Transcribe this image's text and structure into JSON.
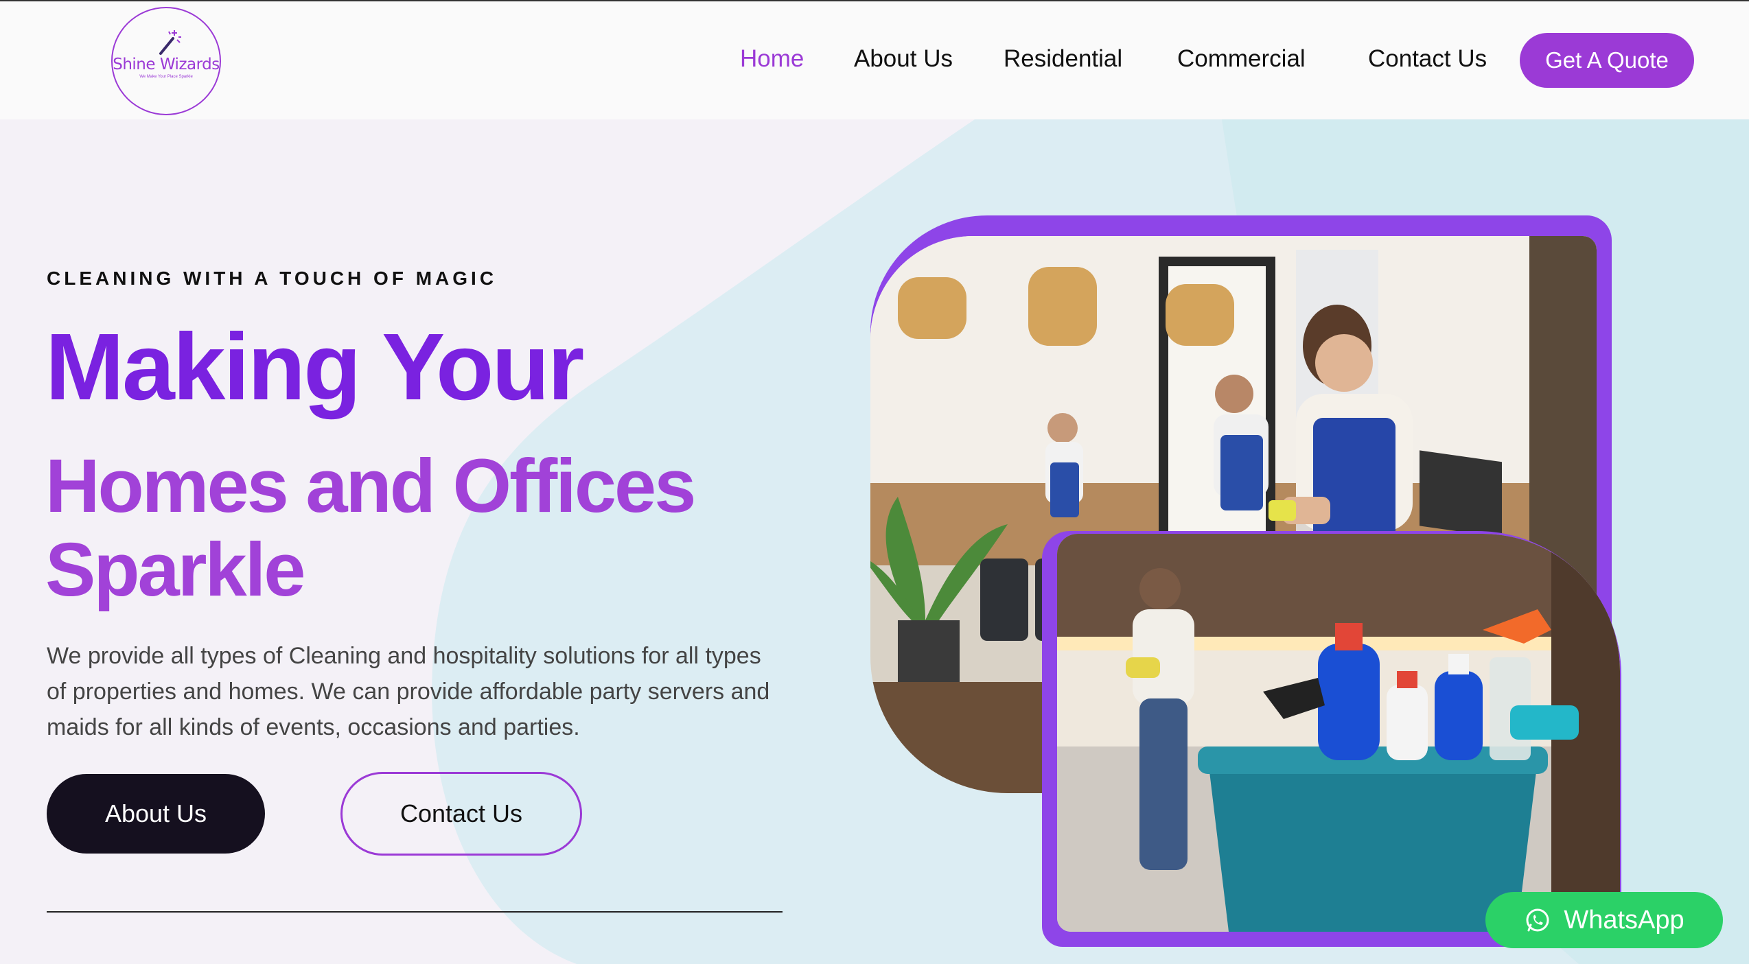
{
  "brand": {
    "name": "Shine Wizards",
    "tagline": "We Make Your Place Sparkle",
    "accent": "#9b3ad6",
    "accent_dark": "#7a22e0"
  },
  "nav": {
    "items": [
      {
        "label": "Home",
        "active": true
      },
      {
        "label": "About Us",
        "active": false
      },
      {
        "label": "Residential",
        "active": false
      },
      {
        "label": "Commercial",
        "active": false
      },
      {
        "label": "Contact Us",
        "active": false
      }
    ],
    "cta": "Get A Quote"
  },
  "hero": {
    "eyebrow": "CLEANING WITH A TOUCH OF MAGIC",
    "headline_line1": "Making Your",
    "headline_line2": "Homes and Offices Sparkle",
    "description": "We provide all types of Cleaning and hospitality solutions for all types of properties and homes. We can provide affordable party servers and maids for all kinds of events, occasions and parties.",
    "primary_button": "About Us",
    "secondary_button": "Contact Us"
  },
  "images": {
    "photo1": "cleaners-wiping-office-tables",
    "photo2": "cleaning-supplies-bucket-kitchen"
  },
  "whatsapp": {
    "label": "WhatsApp",
    "color": "#2bd167",
    "icon": "whatsapp-icon"
  }
}
